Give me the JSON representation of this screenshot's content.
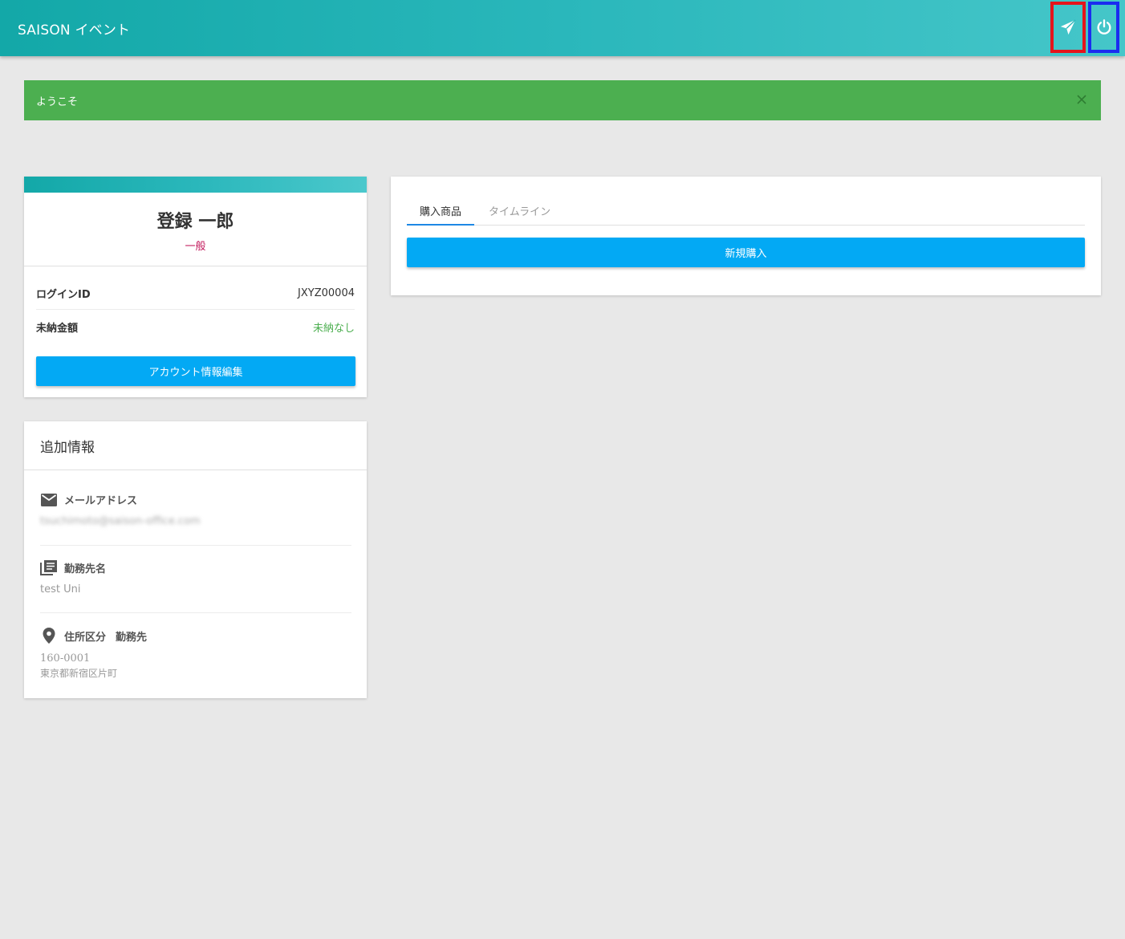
{
  "header": {
    "title": "SAISON イベント",
    "send_icon": "send-icon",
    "power_icon": "power-icon"
  },
  "alert": {
    "message": "ようこそ",
    "close_icon": "close-icon"
  },
  "profile": {
    "name": "登録 一郎",
    "role": "一般",
    "rows": [
      {
        "label": "ログインID",
        "value": "JXYZ00004"
      },
      {
        "label": "未納金額",
        "value": "未納なし"
      }
    ],
    "edit_button": "アカウント情報編集"
  },
  "extra": {
    "title": "追加情報",
    "email": {
      "label": "メールアドレス",
      "value": "tsuchimoto@saison-office.com"
    },
    "workplace": {
      "label": "勤務先名",
      "value": "test Uni"
    },
    "address": {
      "label": "住所区分",
      "type": "勤務先",
      "zip": "160-0001",
      "line": "東京都新宿区片町"
    }
  },
  "main": {
    "tabs": [
      {
        "label": "購入商品",
        "active": true
      },
      {
        "label": "タイムライン",
        "active": false
      }
    ],
    "new_purchase_button": "新規購入"
  },
  "colors": {
    "header_start": "#13a8a8",
    "header_end": "#45c6c9",
    "alert_bg": "#4caf50",
    "primary_button": "#03a9f4",
    "role_text": "#c2185b",
    "status_green": "#4caf50",
    "highlight_red": "#e5141b",
    "highlight_blue": "#1a2cf0"
  }
}
